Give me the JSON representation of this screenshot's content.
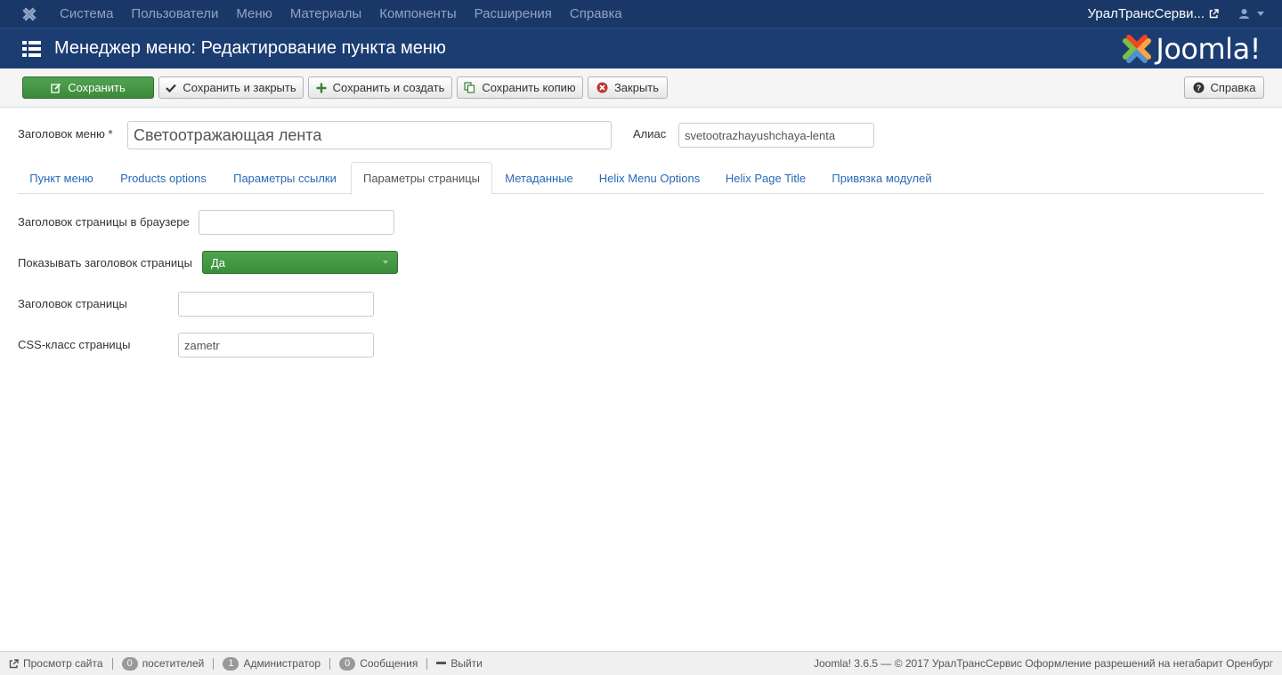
{
  "topnav": {
    "items": [
      "Система",
      "Пользователи",
      "Меню",
      "Материалы",
      "Компоненты",
      "Расширения",
      "Справка"
    ],
    "site_name": "УралТрансСерви...",
    "colors": {
      "bar": "#1a3867",
      "text": "#8fa4c3"
    }
  },
  "header": {
    "title": "Менеджер меню: Редактирование пункта меню",
    "brand": "Joomla!"
  },
  "toolbar": {
    "save": "Сохранить",
    "save_close": "Сохранить и закрыть",
    "save_new": "Сохранить и создать",
    "save_copy": "Сохранить копию",
    "close": "Закрыть",
    "help": "Справка"
  },
  "form": {
    "title_label": "Заголовок меню *",
    "title_value": "Светоотражающая лента",
    "alias_label": "Алиас",
    "alias_value": "svetootrazhayushchaya-lenta"
  },
  "tabs": [
    "Пункт меню",
    "Products options",
    "Параметры ссылки",
    "Параметры страницы",
    "Метаданные",
    "Helix Menu Options",
    "Helix Page Title",
    "Привязка модулей"
  ],
  "page_params": {
    "browser_title_label": "Заголовок страницы в браузере",
    "browser_title_value": "",
    "show_heading_label": "Показывать заголовок страницы",
    "show_heading_value": "Да",
    "page_heading_label": "Заголовок страницы",
    "page_heading_value": "",
    "css_class_label": "CSS-класс страницы",
    "css_class_value": "zametr"
  },
  "statusbar": {
    "view_site": "Просмотр сайта",
    "visitors_count": "0",
    "visitors_label": "посетителей",
    "admins_count": "1",
    "admins_label": "Администратор",
    "messages_count": "0",
    "messages_label": "Сообщения",
    "logout": "Выйти",
    "footer": "Joomla! 3.6.5  —  © 2017 УралТрансСервис Оформление разрешений на негабарит Оренбург"
  }
}
